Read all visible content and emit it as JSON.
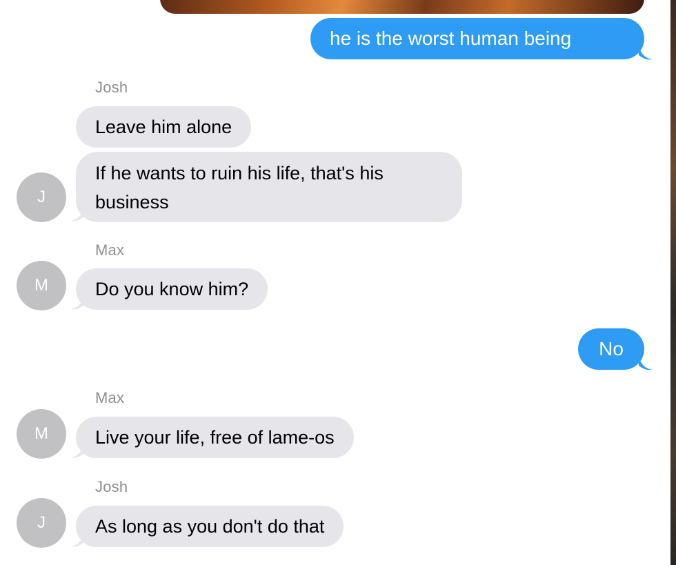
{
  "thread": {
    "messages": [
      {
        "from": "me",
        "text": "he is the worst human being"
      },
      {
        "sender": "Josh",
        "text": "Leave him alone"
      },
      {
        "sender": "Josh",
        "text": "If he wants to ruin his life, that's his business",
        "avatar": "J"
      },
      {
        "sender": "Max",
        "text": "Do you know him?",
        "avatar": "M"
      },
      {
        "from": "me",
        "text": "No"
      },
      {
        "sender": "Max",
        "text": "Live your life, free of lame-os",
        "avatar": "M"
      },
      {
        "sender": "Josh",
        "text": "As long as you don't do that",
        "avatar": "J"
      }
    ]
  },
  "colors": {
    "outgoing_bubble": "#2e9bf5",
    "incoming_bubble": "#e5e5ea",
    "avatar": "#c1c1c4",
    "sender_label": "#8e8e93"
  }
}
